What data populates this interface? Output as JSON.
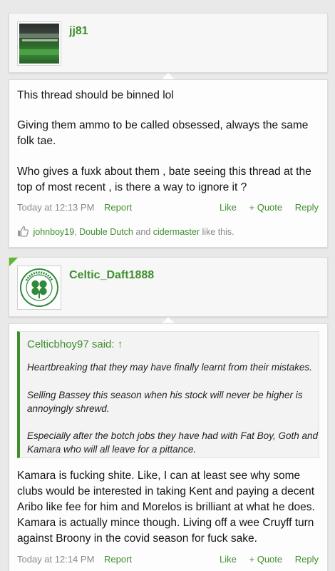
{
  "posts": [
    {
      "username": "jj81",
      "message_lines": [
        "This thread should be binned lol",
        "Giving them ammo to be called obsessed, always the same",
        "folk tae.",
        "Who gives a fuxk about them , bate seeing this thread at the",
        "top of most recent , is there a way to ignore it ?"
      ],
      "timestamp": "Today at 12:13 PM",
      "report_label": "Report",
      "like_label": "Like",
      "quote_label": "+ Quote",
      "reply_label": "Reply",
      "likes": {
        "user1": "johnboy19",
        "separator": ", ",
        "user2": "Double Dutch",
        "and_text": " and ",
        "user3": "cidermaster",
        "suffix": " like this."
      }
    },
    {
      "username": "Celtic_Daft1888",
      "quote": {
        "attribution": "Celticbhoy97 said: ↑",
        "lines": [
          "Heartbreaking that they may have finally learnt from their mistakes.",
          "Selling Bassey this season when his stock will never be higher is",
          "annoyingly shrewd.",
          "Especially after the botch jobs they have had with Fat Boy, Goth and",
          "Kamara who will all leave for a pittance."
        ]
      },
      "message_lines": [
        "Kamara is fucking shite. Like, I can at least see why some",
        "clubs would be interested in taking Kent and paying a decent",
        "Aribo like fee for him and Morelos is brilliant at what he does.",
        "Kamara is actually mince though. Living off a wee Cruyff turn",
        "against Broony in the covid season for fuck sake."
      ],
      "timestamp": "Today at 12:14 PM",
      "report_label": "Report",
      "like_label": "Like",
      "quote_label": "+ Quote",
      "reply_label": "Reply"
    }
  ],
  "colors": {
    "accent": "#3f8f2e",
    "muted": "#8a8a8a",
    "background": "#e9e9e9"
  },
  "icons": {
    "like": "thumbs-up-icon",
    "avatar2": "celtic-crest-icon"
  }
}
